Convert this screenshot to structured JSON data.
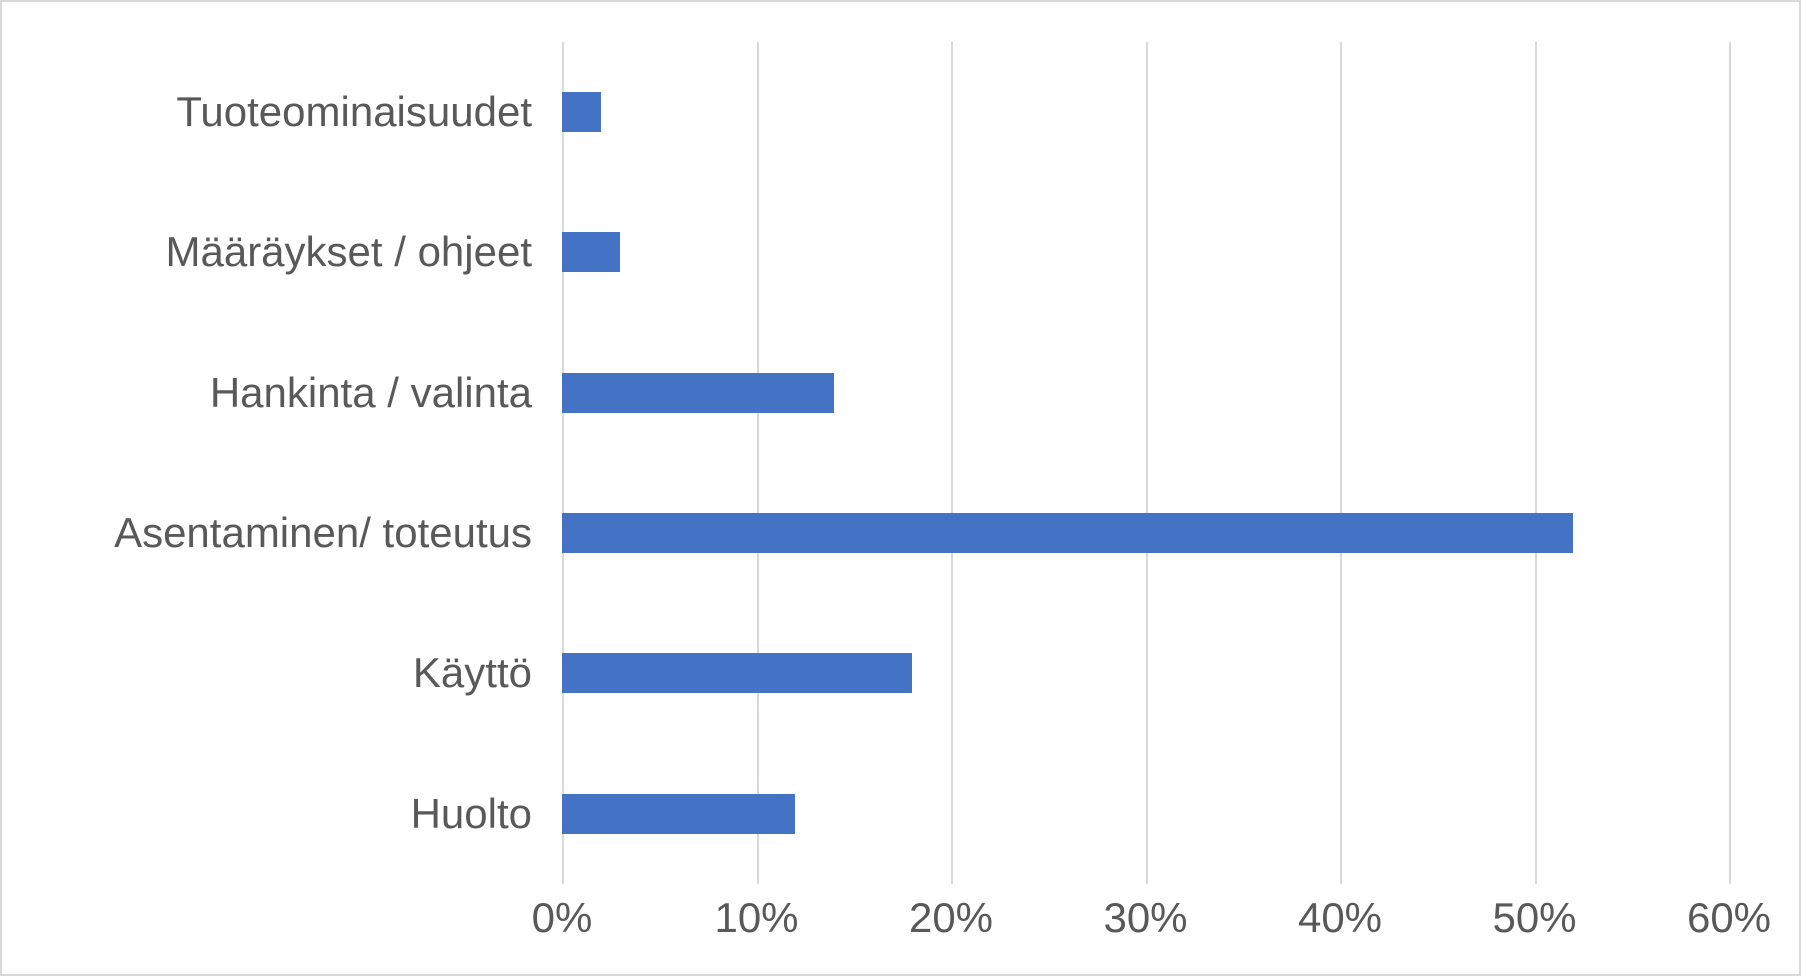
{
  "chart_data": {
    "type": "bar",
    "orientation": "horizontal",
    "categories": [
      "Tuoteominaisuudet",
      "Määräykset / ohjeet",
      "Hankinta / valinta",
      "Asentaminen/ toteutus",
      "Käyttö",
      "Huolto"
    ],
    "values": [
      2,
      3,
      14,
      52,
      18,
      12
    ],
    "value_suffix": "%",
    "xlim": [
      0,
      60
    ],
    "xticks": [
      0,
      10,
      20,
      30,
      40,
      50,
      60
    ],
    "xtick_labels": [
      "0%",
      "10%",
      "20%",
      "30%",
      "40%",
      "50%",
      "60%"
    ],
    "title": "",
    "xlabel": "",
    "ylabel": "",
    "bar_color": "#4472c4",
    "grid_color": "#d9d9d9"
  }
}
